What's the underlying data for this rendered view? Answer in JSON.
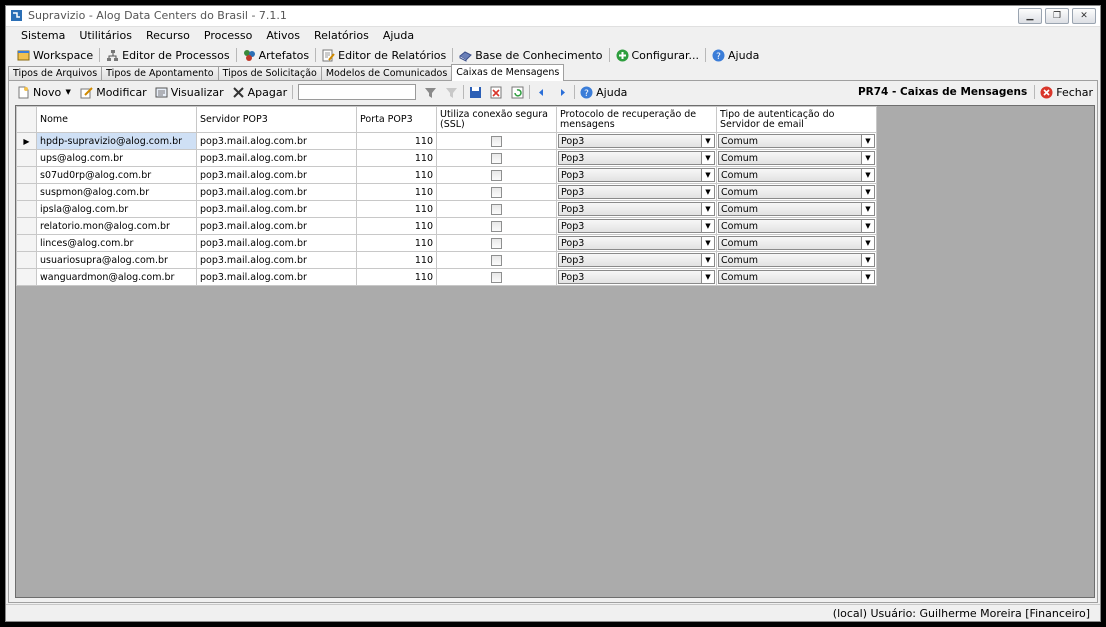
{
  "window": {
    "title": "Supravizio - Alog Data Centers do Brasil - 7.1.1"
  },
  "menu": [
    "Sistema",
    "Utilitários",
    "Recurso",
    "Processo",
    "Ativos",
    "Relatórios",
    "Ajuda"
  ],
  "toolbar": {
    "workspace": "Workspace",
    "process_editor": "Editor de Processos",
    "artifacts": "Artefatos",
    "report_editor": "Editor de Relatórios",
    "knowledge_base": "Base de Conhecimento",
    "configure": "Configurar...",
    "help": "Ajuda"
  },
  "tabs": [
    "Tipos de Arquivos",
    "Tipos de Apontamento",
    "Tipos de Solicitação",
    "Modelos de Comunicados",
    "Caixas de Mensagens"
  ],
  "actions": {
    "new": "Novo",
    "modify": "Modificar",
    "view": "Visualizar",
    "delete": "Apagar",
    "search_value": "",
    "help": "Ajuda",
    "screen_title": "PR74 - Caixas de Mensagens",
    "close": "Fechar"
  },
  "grid": {
    "columns": [
      "Nome",
      "Servidor POP3",
      "Porta POP3",
      "Utiliza conexão segura (SSL)",
      "Protocolo de recuperação de mensagens",
      "Tipo de autenticação do Servidor de email"
    ],
    "rows": [
      {
        "name": "hpdp-supravizio@alog.com.br",
        "server": "pop3.mail.alog.com.br",
        "port": "110",
        "ssl": false,
        "protocol": "Pop3",
        "auth": "Comum"
      },
      {
        "name": "ups@alog.com.br",
        "server": "pop3.mail.alog.com.br",
        "port": "110",
        "ssl": false,
        "protocol": "Pop3",
        "auth": "Comum"
      },
      {
        "name": "s07ud0rp@alog.com.br",
        "server": "pop3.mail.alog.com.br",
        "port": "110",
        "ssl": false,
        "protocol": "Pop3",
        "auth": "Comum"
      },
      {
        "name": "suspmon@alog.com.br",
        "server": "pop3.mail.alog.com.br",
        "port": "110",
        "ssl": false,
        "protocol": "Pop3",
        "auth": "Comum"
      },
      {
        "name": "ipsla@alog.com.br",
        "server": "pop3.mail.alog.com.br",
        "port": "110",
        "ssl": false,
        "protocol": "Pop3",
        "auth": "Comum"
      },
      {
        "name": "relatorio.mon@alog.com.br",
        "server": "pop3.mail.alog.com.br",
        "port": "110",
        "ssl": false,
        "protocol": "Pop3",
        "auth": "Comum"
      },
      {
        "name": "linces@alog.com.br",
        "server": "pop3.mail.alog.com.br",
        "port": "110",
        "ssl": false,
        "protocol": "Pop3",
        "auth": "Comum"
      },
      {
        "name": "usuariosupra@alog.com.br",
        "server": "pop3.mail.alog.com.br",
        "port": "110",
        "ssl": false,
        "protocol": "Pop3",
        "auth": "Comum"
      },
      {
        "name": "wanguardmon@alog.com.br",
        "server": "pop3.mail.alog.com.br",
        "port": "110",
        "ssl": false,
        "protocol": "Pop3",
        "auth": "Comum"
      }
    ]
  },
  "status": {
    "text": "(local)  Usuário: Guilherme Moreira [Financeiro]"
  },
  "icons": {
    "new": "new-document-icon",
    "modify": "edit-icon",
    "view": "view-icon",
    "delete": "delete-x-icon",
    "close": "close-circle-icon"
  },
  "colors": {
    "grid_background": "#ababab",
    "selected_cell": "#cfe0f5",
    "close_icon": "#d9362b"
  }
}
